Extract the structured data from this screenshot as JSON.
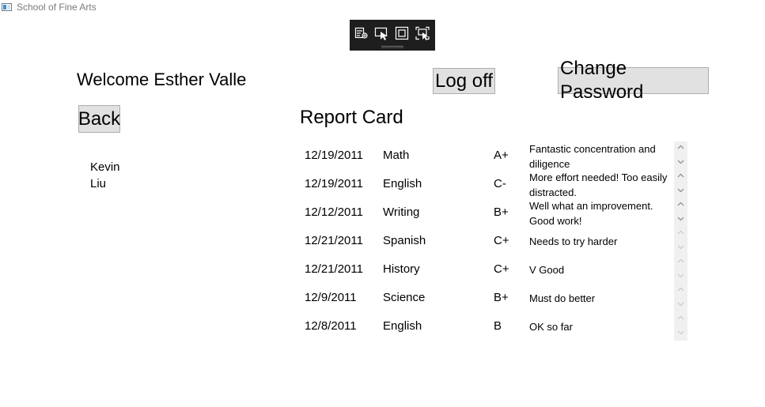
{
  "window": {
    "title": "School of Fine Arts"
  },
  "header": {
    "welcome": "Welcome Esther Valle",
    "logoff_label": "Log off",
    "change_password_label": "Change Password",
    "back_label": "Back"
  },
  "students": {
    "name_line1": "Kevin",
    "name_line2": "Liu"
  },
  "report": {
    "title": "Report Card",
    "rows": [
      {
        "date": "12/19/2011",
        "subject": "Math",
        "grade": "A+",
        "comment": "Fantastic concentration and diligence"
      },
      {
        "date": "12/19/2011",
        "subject": "English",
        "grade": "C-",
        "comment": "More effort needed! Too easily distracted."
      },
      {
        "date": "12/12/2011",
        "subject": "Writing",
        "grade": "B+",
        "comment": "Well what an improvement. Good work!"
      },
      {
        "date": "12/21/2011",
        "subject": "Spanish",
        "grade": "C+",
        "comment": "Needs to try harder"
      },
      {
        "date": "12/21/2011",
        "subject": "History",
        "grade": "C+",
        "comment": "V Good"
      },
      {
        "date": "12/9/2011",
        "subject": "Science",
        "grade": "B+",
        "comment": "Must do better"
      },
      {
        "date": "12/8/2011",
        "subject": "English",
        "grade": "B",
        "comment": "OK so far"
      }
    ]
  },
  "icons": {
    "app": "app-window-icon",
    "toolbar": [
      "live-visual-tree-icon",
      "select-element-icon",
      "display-layout-adorners-icon",
      "track-focused-element-icon"
    ]
  },
  "colors": {
    "toolbar_bg": "#1e1e1e",
    "button_bg": "#e1e1e1",
    "button_border": "#adadad",
    "scroll_bg": "#f0f0f0"
  }
}
